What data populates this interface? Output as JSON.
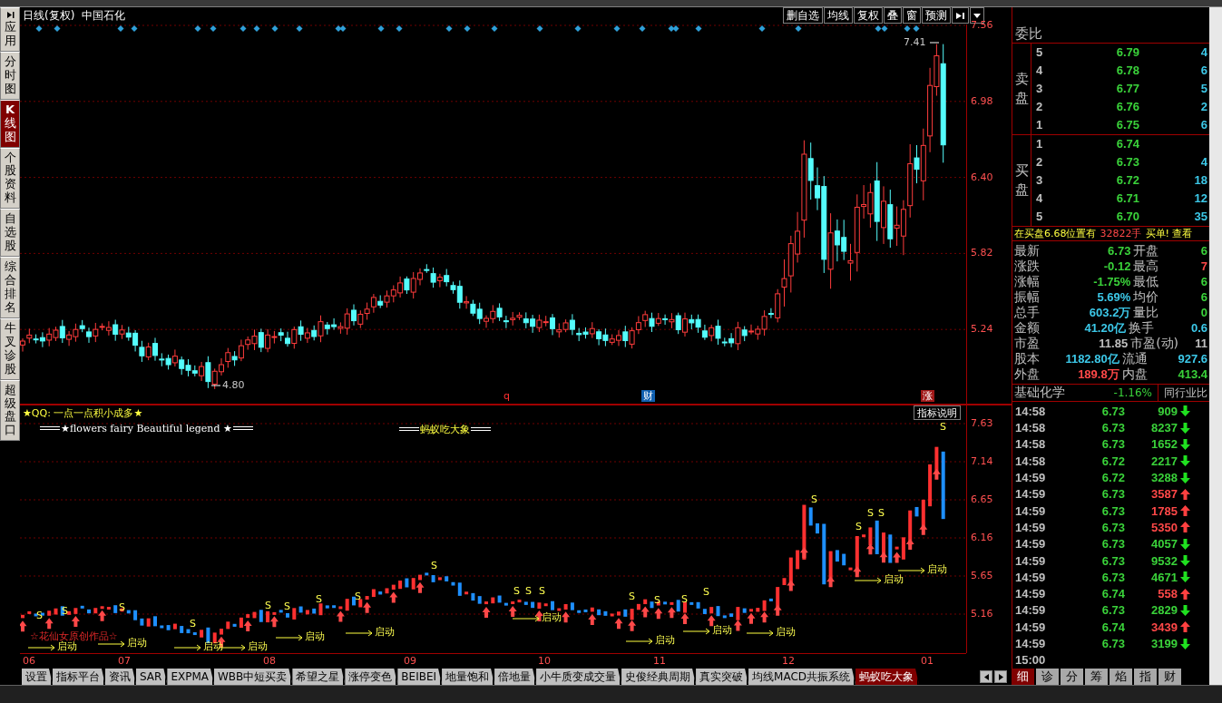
{
  "sidebar_tabs": [
    {
      "label": "应用",
      "kind": "app",
      "selected": false
    },
    {
      "label": "分时图",
      "kind": "view",
      "selected": false
    },
    {
      "label": "**K**线图",
      "kind": "view",
      "selected": true
    },
    {
      "label": "个股资料",
      "kind": "view",
      "selected": false
    },
    {
      "label": "自选股",
      "kind": "view",
      "selected": false
    },
    {
      "label": "综合排名",
      "kind": "view",
      "selected": false
    },
    {
      "label": "牛叉诊股",
      "kind": "view",
      "selected": false
    },
    {
      "label": "超级盘口",
      "kind": "view",
      "selected": false
    }
  ],
  "chart_header": {
    "period": "日线(复权)",
    "name": "中国石化",
    "buttons": [
      "删自选",
      "均线",
      "复权",
      "叠",
      "窗",
      "预测"
    ]
  },
  "price_axis": [
    "7.56",
    "6.98",
    "6.40",
    "5.82",
    "5.24"
  ],
  "price_marks": {
    "high": "7.41",
    "low": "4.80"
  },
  "event_markers": [
    {
      "label": "q",
      "kind": "plain"
    },
    {
      "label": "财",
      "kind": "finance"
    },
    {
      "label": "涨",
      "kind": "limit"
    }
  ],
  "indicator": {
    "title": "★QQ: 一点一点积小成多★",
    "help_button": "指标说明",
    "legend_left": "★flowers fairy Beautiful legend ★",
    "legend_right": "蚂蚁吃大象",
    "credit": "☆花仙女原创作品☆",
    "axis": [
      "7.63",
      "7.14",
      "6.65",
      "6.16",
      "5.65",
      "5.16"
    ],
    "signals": [
      {
        "kind": "sell",
        "label": "S"
      },
      {
        "kind": "sell",
        "label": "S"
      },
      {
        "kind": "sell",
        "label": "S"
      },
      {
        "kind": "sell",
        "label": "S"
      },
      {
        "kind": "sell",
        "label": "S"
      },
      {
        "kind": "sell",
        "label": "S"
      },
      {
        "kind": "sell",
        "label": "S"
      },
      {
        "kind": "sell",
        "label": "S"
      },
      {
        "kind": "sell",
        "label": "S"
      },
      {
        "kind": "sell",
        "label": "S"
      },
      {
        "kind": "sell",
        "label": "S"
      },
      {
        "kind": "sell",
        "label": "S"
      },
      {
        "kind": "sell",
        "label": "S"
      },
      {
        "kind": "sell",
        "label": "S"
      },
      {
        "kind": "sell",
        "label": "S"
      },
      {
        "kind": "sell",
        "label": "S"
      },
      {
        "kind": "sell",
        "label": "S"
      },
      {
        "kind": "sell",
        "label": "S"
      },
      {
        "kind": "sell",
        "label": "S"
      },
      {
        "kind": "sell",
        "label": "S"
      },
      {
        "kind": "sell",
        "label": "S"
      },
      {
        "kind": "start",
        "label": "启动"
      },
      {
        "kind": "start",
        "label": "启动"
      },
      {
        "kind": "start",
        "label": "启动"
      },
      {
        "kind": "start",
        "label": "启动"
      },
      {
        "kind": "start",
        "label": "启动"
      },
      {
        "kind": "start",
        "label": "启动"
      },
      {
        "kind": "start",
        "label": "启动"
      },
      {
        "kind": "start",
        "label": "启动"
      },
      {
        "kind": "start",
        "label": "启动"
      },
      {
        "kind": "start",
        "label": "启动"
      },
      {
        "kind": "start",
        "label": "启动"
      },
      {
        "kind": "start",
        "label": "启动"
      }
    ]
  },
  "months": [
    "06",
    "07",
    "08",
    "09",
    "10",
    "11",
    "12",
    "01"
  ],
  "indicator_tabs": [
    {
      "label": "设置",
      "selected": false
    },
    {
      "label": "指标平台",
      "selected": false
    },
    {
      "label": "资讯",
      "selected": false
    },
    {
      "label": "SAR",
      "selected": false
    },
    {
      "label": "EXPMA",
      "selected": false
    },
    {
      "label": "WBB中短买卖",
      "selected": false
    },
    {
      "label": "希望之星",
      "selected": false
    },
    {
      "label": "涨停变色",
      "selected": false
    },
    {
      "label": "BEIBEI",
      "selected": false
    },
    {
      "label": "地量饱和",
      "selected": false
    },
    {
      "label": "倍地量",
      "selected": false
    },
    {
      "label": "小牛质变成交量",
      "selected": false
    },
    {
      "label": "史俊经典周期",
      "selected": false
    },
    {
      "label": "真实突破",
      "selected": false
    },
    {
      "label": "均线MACD共振系统",
      "selected": false
    },
    {
      "label": "蚂蚁吃大象",
      "selected": true
    }
  ],
  "quote": {
    "title": "委比",
    "sell_label": "卖盘",
    "buy_label": "买盘",
    "sell": [
      {
        "rank": "5",
        "price": "6.79",
        "volume": "4"
      },
      {
        "rank": "4",
        "price": "6.78",
        "volume": "6"
      },
      {
        "rank": "3",
        "price": "6.77",
        "volume": "5"
      },
      {
        "rank": "2",
        "price": "6.76",
        "volume": "2"
      },
      {
        "rank": "1",
        "price": "6.75",
        "volume": "6"
      }
    ],
    "buy": [
      {
        "rank": "1",
        "price": "6.74"
      },
      {
        "rank": "2",
        "price": "6.73",
        "volume": "4"
      },
      {
        "rank": "3",
        "price": "6.72",
        "volume": "18"
      },
      {
        "rank": "4",
        "price": "6.71",
        "volume": "12"
      },
      {
        "rank": "5",
        "price": "6.70",
        "volume": "35"
      }
    ],
    "notice": {
      "text": "在买盘6.68位置有",
      "volume": "32822手",
      "tail": "买单! 查看"
    },
    "stats": [
      {
        "left": {
          "label": "最新",
          "value": "6.73",
          "color": "#3ad23a"
        },
        "right": {
          "label": "开盘",
          "value": "6",
          "color": "#3ad23a"
        }
      },
      {
        "left": {
          "label": "涨跌",
          "value": "-0.12",
          "color": "#3ad23a"
        },
        "right": {
          "label": "最高",
          "value": "7",
          "color": "#ff4848"
        }
      },
      {
        "left": {
          "label": "涨幅",
          "value": "-1.75%",
          "color": "#3ad23a"
        },
        "right": {
          "label": "最低",
          "value": "6",
          "color": "#3ad23a"
        }
      },
      {
        "left": {
          "label": "振幅",
          "value": "5.69%",
          "color": "#3cc8e8"
        },
        "right": {
          "label": "均价",
          "value": "6",
          "color": "#3ad23a"
        }
      },
      {
        "left": {
          "label": "总手",
          "value": "603.2万",
          "color": "#3cc8e8"
        },
        "right": {
          "label": "量比",
          "value": "0",
          "color": "#3ad23a"
        }
      },
      {
        "left": {
          "label": "金额",
          "value": "41.20亿",
          "color": "#3cc8e8"
        },
        "right": {
          "label": "换手",
          "value": "0.6",
          "color": "#3cc8e8"
        }
      },
      {
        "left": {
          "label": "市盈",
          "value": "11.85",
          "color": "#c0c0c0"
        },
        "right": {
          "label": "市盈(动)",
          "value": "11",
          "color": "#c0c0c0"
        }
      },
      {
        "left": {
          "label": "股本",
          "value": "1182.80亿",
          "color": "#3cc8e8"
        },
        "right": {
          "label": "流通",
          "value": "927.6",
          "color": "#3cc8e8"
        }
      },
      {
        "left": {
          "label": "外盘",
          "value": "189.8万",
          "color": "#ff4848"
        },
        "right": {
          "label": "内盘",
          "value": "413.4",
          "color": "#3ad23a"
        }
      }
    ],
    "industry": {
      "name": "基础化学",
      "change": "-1.16%",
      "button": "同行业比"
    }
  },
  "trades": [
    {
      "time": "14:58",
      "price": "6.73",
      "volume": "909",
      "buy": false
    },
    {
      "time": "14:58",
      "price": "6.73",
      "volume": "8237",
      "buy": false
    },
    {
      "time": "14:58",
      "price": "6.73",
      "volume": "1652",
      "buy": false
    },
    {
      "time": "14:58",
      "price": "6.72",
      "volume": "2217",
      "buy": false
    },
    {
      "time": "14:59",
      "price": "6.72",
      "volume": "3288",
      "buy": false
    },
    {
      "time": "14:59",
      "price": "6.73",
      "volume": "3587",
      "buy": true
    },
    {
      "time": "14:59",
      "price": "6.73",
      "volume": "1785",
      "buy": true
    },
    {
      "time": "14:59",
      "price": "6.73",
      "volume": "5350",
      "buy": true
    },
    {
      "time": "14:59",
      "price": "6.73",
      "volume": "4057",
      "buy": false
    },
    {
      "time": "14:59",
      "price": "6.73",
      "volume": "9532",
      "buy": false
    },
    {
      "time": "14:59",
      "price": "6.73",
      "volume": "4671",
      "buy": false
    },
    {
      "time": "14:59",
      "price": "6.74",
      "volume": "558",
      "buy": true
    },
    {
      "time": "14:59",
      "price": "6.73",
      "volume": "2829",
      "buy": false
    },
    {
      "time": "14:59",
      "price": "6.74",
      "volume": "3439",
      "buy": true
    },
    {
      "time": "14:59",
      "price": "6.73",
      "volume": "3199",
      "buy": false
    },
    {
      "time": "15:00"
    }
  ],
  "panel_tabs": [
    {
      "label": "细",
      "selected": true
    },
    {
      "label": "诊",
      "selected": false
    },
    {
      "label": "分",
      "selected": false
    },
    {
      "label": "筹",
      "selected": false
    },
    {
      "label": "焰",
      "selected": false
    },
    {
      "label": "指",
      "selected": false
    },
    {
      "label": "财",
      "selected": false
    }
  ]
}
